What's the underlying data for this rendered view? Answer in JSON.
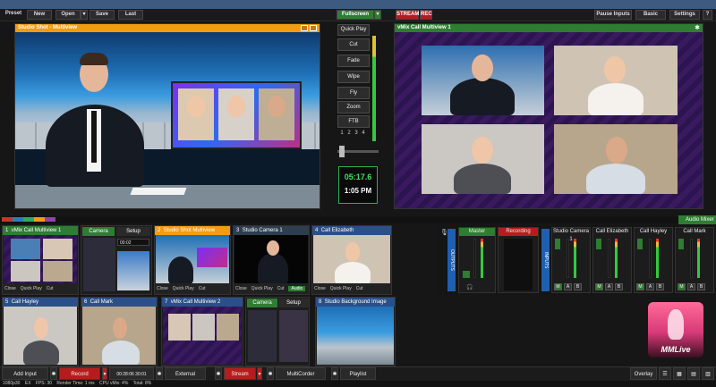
{
  "toolbar": {
    "preset": "Preset",
    "new": "New",
    "open": "Open",
    "save": "Save",
    "last": "Last",
    "fullscreen": "Fullscreen",
    "stream": "STREAM",
    "rec": "REC",
    "pause_inputs": "Pause Inputs",
    "basic": "Basic",
    "settings": "Settings"
  },
  "preview": {
    "title": "Studio Shot - Multiview"
  },
  "output": {
    "title": "vMix Call Multiview 1"
  },
  "transitions": {
    "quick_play": "Quick Play",
    "cut": "Cut",
    "fade": "Fade",
    "wipe": "Wipe",
    "fly": "Fly",
    "zoom": "Zoom",
    "ftb": "FTB",
    "numbers": [
      "1",
      "2",
      "3",
      "4"
    ]
  },
  "clock": {
    "countdown": "05:17.6",
    "time": "1:05 PM"
  },
  "inputs": [
    {
      "num": "1",
      "name": "vMix Call Multiview 1",
      "color": "#2e7d32"
    },
    {
      "num": "2",
      "name": "Studio Shot Multiview",
      "color": "#f39c12"
    },
    {
      "num": "3",
      "name": "Studio Camera 1",
      "color": "#2c3e50"
    },
    {
      "num": "4",
      "name": "Call Elizabeth",
      "color": "#2b4f8a"
    },
    {
      "num": "5",
      "name": "Call Hayley",
      "color": "#2b4f8a"
    },
    {
      "num": "6",
      "name": "Call Mark",
      "color": "#2b4f8a"
    },
    {
      "num": "7",
      "name": "vMix Call Multiview 2",
      "color": "#2b4f8a"
    },
    {
      "num": "8",
      "name": "Studio Background Image",
      "color": "#2b4f8a"
    }
  ],
  "camera_tile": {
    "camera": "Camera",
    "setup": "Setup",
    "field": "00:02"
  },
  "tile_bar": {
    "close": "Close",
    "quick_play": "Quick Play",
    "cut": "Cut",
    "audio": "Audio"
  },
  "audio": {
    "mixer_label": "Audio Mixer",
    "outputs": "OUTPUTS",
    "inputs": "INPUTS",
    "master": "Master",
    "recording": "Recording",
    "channels": [
      "Studio Camera 1",
      "Call Elizabeth",
      "Call Hayley",
      "Call Mark"
    ],
    "m": "M",
    "a": "A",
    "b": "B"
  },
  "logo": {
    "text": "MMLive"
  },
  "bottombar": {
    "add_input": "Add Input",
    "record": "Record",
    "timecode": "00:28:06 30:01",
    "external": "External",
    "stream": "Stream",
    "multicorder": "MultiCorder",
    "playlist": "Playlist",
    "overlay": "Overlay"
  },
  "statusbar": {
    "res": "1080p30",
    "ex": "EX",
    "fps_label": "FPS:",
    "fps": "30",
    "render_label": "Render Time:",
    "render": "1 ms",
    "cpu_label": "CPU vMix:",
    "cpu": "4%",
    "total_label": "Total:",
    "total": "8%"
  }
}
